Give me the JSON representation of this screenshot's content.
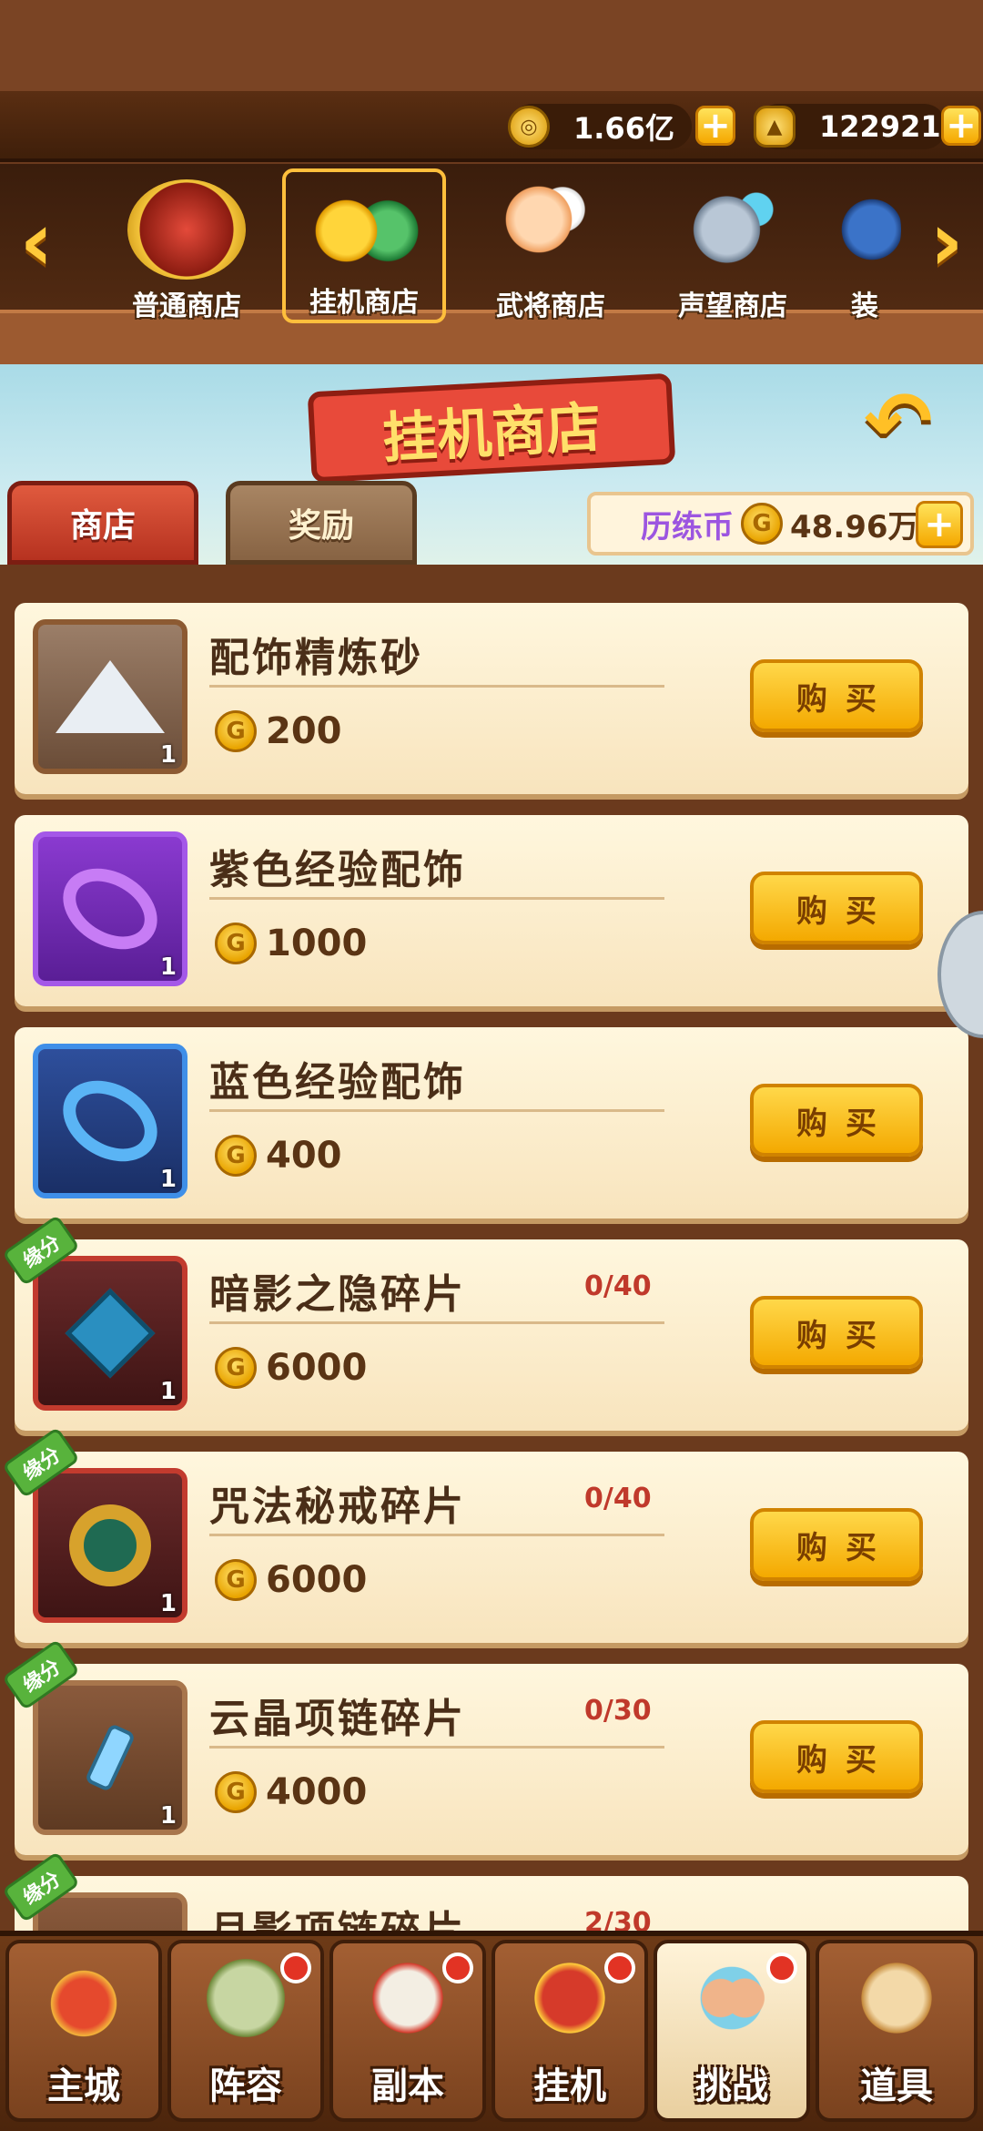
{
  "resources": {
    "copper": "1.66亿",
    "ingot": "122921"
  },
  "shop_tabs": [
    {
      "label": "普通商店"
    },
    {
      "label": "挂机商店"
    },
    {
      "label": "武将商店"
    },
    {
      "label": "声望商店"
    },
    {
      "label": "装"
    }
  ],
  "header": {
    "title": "挂机商店",
    "sub_tabs": [
      "商店",
      "奖励"
    ],
    "currency_name": "历练币",
    "currency_value": "48.96万"
  },
  "items": [
    {
      "name": "配饰精炼砂",
      "price": "200",
      "qty": "1",
      "count": ""
    },
    {
      "name": "紫色经验配饰",
      "price": "1000",
      "qty": "1",
      "count": ""
    },
    {
      "name": "蓝色经验配饰",
      "price": "400",
      "qty": "1",
      "count": ""
    },
    {
      "name": "暗影之隐碎片",
      "price": "6000",
      "qty": "1",
      "count": "0/40",
      "tag": "缘分"
    },
    {
      "name": "咒法秘戒碎片",
      "price": "6000",
      "qty": "1",
      "count": "0/40",
      "tag": "缘分"
    },
    {
      "name": "云晶项链碎片",
      "price": "4000",
      "qty": "1",
      "count": "0/30",
      "tag": "缘分"
    },
    {
      "name": "月影项链碎片",
      "price": "",
      "qty": "",
      "count": "2/30",
      "tag": "缘分"
    }
  ],
  "buy_label": "购买",
  "bottom_nav": [
    "主城",
    "阵容",
    "副本",
    "挂机",
    "挑战",
    "道具"
  ]
}
